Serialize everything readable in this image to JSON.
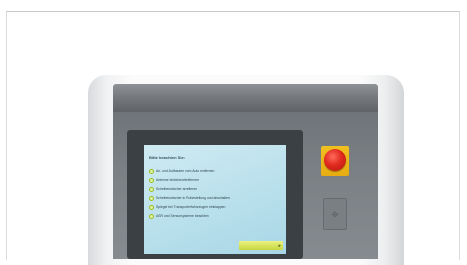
{
  "screen": {
    "heading": "Bitte beachten Sie:",
    "status": "",
    "steps": [
      "An- und Aufbauten vom Auto entfernen",
      "Antenne einfahren/entfernen",
      "Scheibenwischer arretieren",
      "Scheibenwischer in Ruhestellung und abschalten",
      "Spiegel bei Transporterfahrzeugen einklappen",
      "ASR und Sensorsysteme beachten"
    ],
    "button_label": ""
  },
  "icons": {
    "check": "check-circle-icon",
    "arrow": "arrow-right-icon",
    "reader": "nfc-card-reader-icon"
  },
  "colors": {
    "screen_bg": "#b9e0ec",
    "check_accent": "#9bbf1c",
    "button": "#d6e35a",
    "estop_red": "#e02a1e",
    "estop_plate": "#f0c020"
  }
}
